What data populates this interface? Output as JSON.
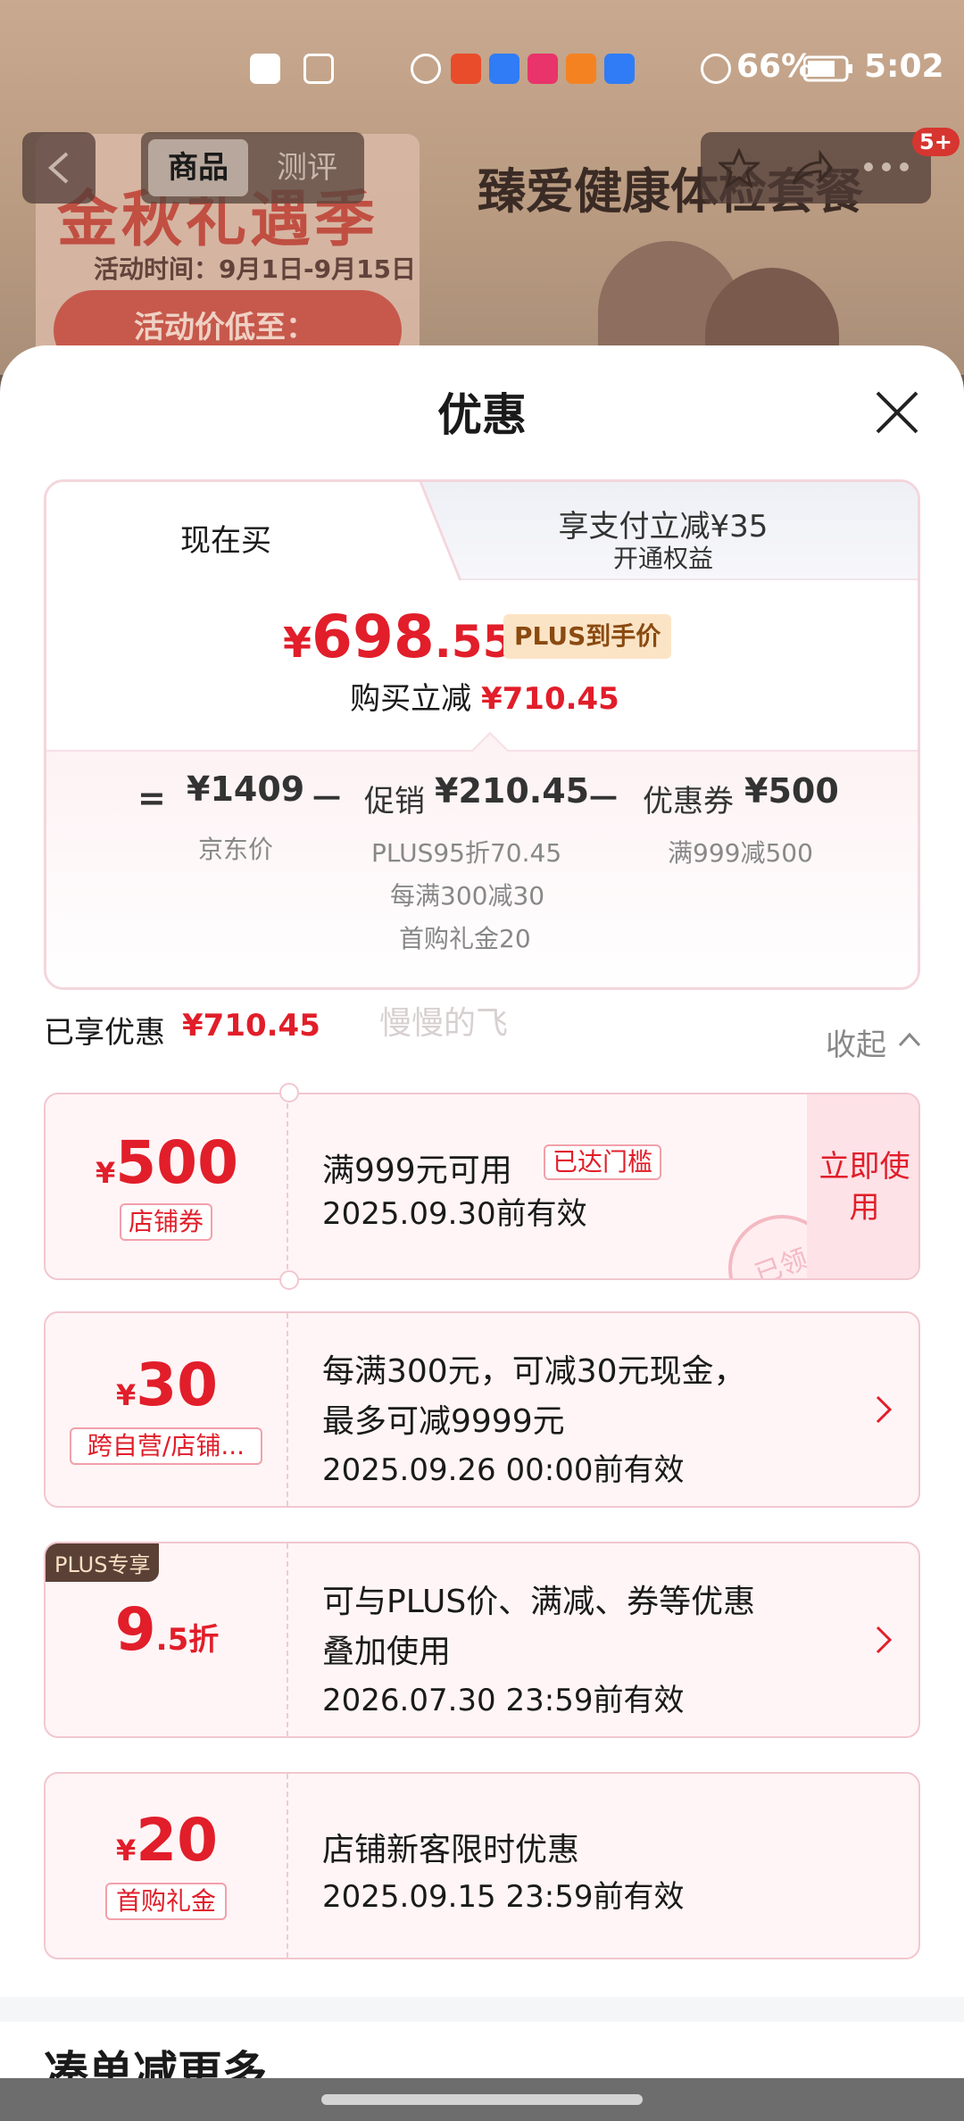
{
  "background": {
    "banner_big": "金秋礼遇季",
    "banner_small": "活动时间：9月1日-9月15日",
    "banner_bar": "活动价低至：",
    "product_title": "臻爱健康体检套餐",
    "tabs": [
      "商品",
      "测评"
    ],
    "badge": "5+"
  },
  "status_bar": {
    "battery": "66%",
    "time": "5:02"
  },
  "sheet": {
    "title": "优惠",
    "tab_now": "现在买",
    "tab_pay_line1": "享支付立减¥35",
    "tab_pay_line2": "开通权益",
    "final_price": {
      "currency": "¥",
      "integer": "698",
      "decimal": ".55"
    },
    "plus_tag": "PLUS到手价",
    "instant_cut_label": "购买立减",
    "instant_cut_value": "¥710.45",
    "breakdown": {
      "eq": "=",
      "jd_price": "¥1409",
      "jd_price_label": "京东价",
      "minus1": "－",
      "promo_label": "促销",
      "promo_value": "¥210.45",
      "promo_items": [
        "PLUS95折70.45",
        "每满300减30",
        "首购礼金20"
      ],
      "minus2": "－",
      "coupon_label": "优惠券",
      "coupon_value": "¥500",
      "coupon_rule": "满999减500"
    },
    "saved_label": "已享优惠",
    "saved_value": "¥710.45",
    "watermark": "慢慢的飞",
    "collapse_label": "收起"
  },
  "coupons": [
    {
      "currency": "¥",
      "amount": "500",
      "tag": "店铺券",
      "line1": "满999元可用",
      "threshold_tag": "已达门槛",
      "line2": "2025.09.30前有效",
      "action": "立即使用",
      "stamp": "已领"
    },
    {
      "currency": "¥",
      "amount": "30",
      "tag": "跨自营/店铺...",
      "line1a": "每满300元，可减30元现金，",
      "line1b": "最多可减9999元",
      "line2": "2025.09.26 00:00前有效"
    },
    {
      "plus_corner": "PLUS专享",
      "amount": "9",
      "suffix": ".5折",
      "line1a": "可与PLUS价、满减、券等优惠",
      "line1b": "叠加使用",
      "line2": "2026.07.30 23:59前有效"
    },
    {
      "currency": "¥",
      "amount": "20",
      "tag": "首购礼金",
      "line1": "店铺新客限时优惠",
      "line2": "2025.09.15 23:59前有效"
    }
  ],
  "more_title": "凑单减更多",
  "colors": {
    "accent": "#e11e2a",
    "plus_tag_bg": "#fbe4c6",
    "coupon_bg": "#fff5f6"
  }
}
